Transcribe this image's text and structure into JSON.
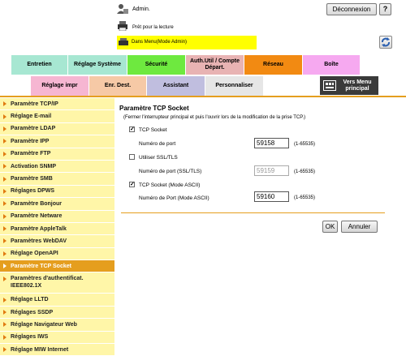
{
  "header": {
    "user_label": "Admin.",
    "logout_label": "Déconnexion",
    "help_label": "?",
    "status_text": "Prêt pour la lecture",
    "mode_text": "Dans Menu(Mode Admin)"
  },
  "tabs_row1": [
    {
      "label": "Entretien",
      "color": "#a7e7d2"
    },
    {
      "label": "Réglage Système",
      "color": "#a7e7d2"
    },
    {
      "label": "Sécurité",
      "color": "#6ee93f"
    },
    {
      "label": "Auth.Util / Compte Départ.",
      "color": "#e8b3b3"
    },
    {
      "label": "Réseau",
      "color": "#f28a12"
    },
    {
      "label": "Boîte",
      "color": "#f6a9f0"
    }
  ],
  "tabs_row2": [
    {
      "label": "Réglage impr",
      "color": "#f6b6d2"
    },
    {
      "label": "Enr. Dest.",
      "color": "#f6c9a6"
    },
    {
      "label": "Assistant",
      "color": "#c0bedf"
    },
    {
      "label": "Personnaliser",
      "color": "#e6e6e6"
    }
  ],
  "vers_menu_label": "Vers Menu principal",
  "sidebar": {
    "items": [
      "Paramètre TCP/IP",
      "Réglage E-mail",
      "Paramètre LDAP",
      "Paramètre IPP",
      "Paramètre FTP",
      "Activation SNMP",
      "Paramètre SMB",
      "Réglages DPWS",
      "Paramètre Bonjour",
      "Paramètre Netware",
      "Paramètre AppleTalk",
      "Paramètres WebDAV",
      "Réglage OpenAPI",
      "Paramètre TCP Socket",
      "Paramètres d'authentificat. IEEE802.1X",
      "Réglage LLTD",
      "Réglages SSDP",
      "Réglage Navigateur Web",
      "Réglages IWS",
      "Réglage MIW Internet"
    ],
    "active_index": 13
  },
  "content": {
    "title": "Paramètre TCP Socket",
    "note": "(Fermer l'interrupteur principal et puis l'ouvrir lors de la modification de la prise TCP.)",
    "tcp_socket": {
      "label": "TCP Socket",
      "checked": "✓",
      "port_label": "Numéro de port",
      "port_value": "59158",
      "range": "(1-65535)"
    },
    "ssl": {
      "label": "Utiliser SSL/TLS",
      "checked": "",
      "port_label": "Numéro de port (SSL/TLS)",
      "port_value": "59159",
      "range": "(1-65535)"
    },
    "ascii": {
      "label": "TCP Socket (Mode ASCII)",
      "checked": "✓",
      "port_label": "Numéro de Port (Mode ASCII)",
      "port_value": "59160",
      "range": "(1-65535)"
    },
    "ok_label": "OK",
    "cancel_label": "Annuler"
  }
}
